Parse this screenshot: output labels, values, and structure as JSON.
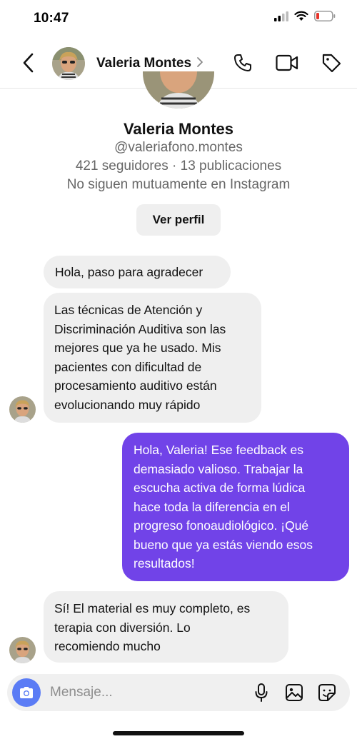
{
  "status_bar": {
    "time": "10:47",
    "battery_color": "#e5332a"
  },
  "header": {
    "contact_name": "Valeria Montes",
    "icons": [
      "back-chevron-icon",
      "avatar",
      "chevron-right-icon",
      "phone-icon",
      "video-camera-icon",
      "tag-icon"
    ]
  },
  "profile": {
    "name": "Valeria Montes",
    "handle": "@valeriafono.montes",
    "stats": "421 seguidores · 13 publicaciones",
    "mutual": "No siguen mutuamente en Instagram",
    "view_profile_label": "Ver perfil"
  },
  "messages": [
    {
      "direction": "incoming",
      "text": "Hola, paso para agradecer"
    },
    {
      "direction": "incoming",
      "lines": [
        "Las técnicas de Atención y",
        "Discriminación Auditiva son las",
        "mejores que ya he usado. Mis",
        "pacientes con dificultad de",
        "procesamiento auditivo están",
        "evolucionando muy rápido"
      ]
    },
    {
      "direction": "outgoing",
      "lines": [
        "Hola, Valeria! Ese feedback es",
        "demasiado valioso. Trabajar la",
        "escucha activa de forma lúdica",
        "hace toda la diferencia en el",
        "progreso fonoaudiológico. ¡Qué",
        "bueno que ya estás viendo esos",
        "resultados!"
      ]
    },
    {
      "direction": "incoming",
      "lines": [
        "Sí! El material es muy completo, es",
        "terapia con diversión. Lo",
        "recomiendo mucho"
      ]
    }
  ],
  "composer": {
    "placeholder": "Mensaje...",
    "icons": [
      "camera-icon",
      "microphone-icon",
      "gallery-icon",
      "sticker-icon"
    ]
  },
  "colors": {
    "outgoing_bubble": "#7143e8",
    "incoming_bubble": "#efefef",
    "camera_button": "#5b7cf5"
  }
}
